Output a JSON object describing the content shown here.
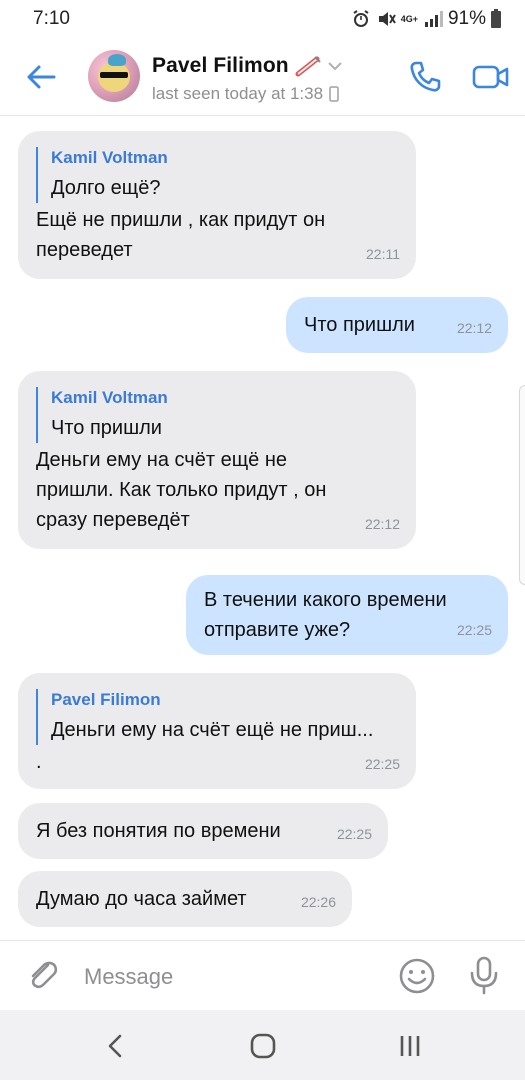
{
  "status_bar": {
    "time": "7:10",
    "network": "4G+",
    "battery": "91%"
  },
  "header": {
    "contact_name": "Pavel Filimon",
    "last_seen": "last seen today at 1:38"
  },
  "messages": [
    {
      "direction": "incoming",
      "reply_author": "Kamil Voltman",
      "reply_quote": "Долго ещё?",
      "text": "Ещё не пришли , как придут он\nпереведет",
      "time": "22:11"
    },
    {
      "direction": "outgoing",
      "text": "Что  пришли",
      "time": "22:12"
    },
    {
      "direction": "incoming",
      "reply_author": "Kamil Voltman",
      "reply_quote": "Что  пришли",
      "text": "Деньги ему на счёт ещё не\nпришли. Как только придут , он\nсразу переведёт",
      "time": "22:12"
    },
    {
      "direction": "outgoing",
      "text": "В течении какого времени\nотправите уже?",
      "time": "22:25"
    },
    {
      "direction": "incoming",
      "reply_author": "Pavel Filimon",
      "reply_quote": "Деньги ему на счёт ещё не приш...",
      "text": ".",
      "time": "22:25"
    },
    {
      "direction": "incoming",
      "text": "Я без понятия по времени",
      "time": "22:25"
    },
    {
      "direction": "incoming",
      "text": "Думаю до часа займет",
      "time": "22:26"
    }
  ],
  "input": {
    "placeholder": "Message"
  },
  "icons": {
    "back": "back-arrow-icon",
    "phone": "phone-icon",
    "video": "video-camera-icon",
    "attach": "paperclip-icon",
    "emoji": "emoji-icon",
    "mic": "microphone-icon"
  },
  "colors": {
    "accent": "#3a86e0",
    "incoming_bubble": "#ebebee",
    "outgoing_bubble": "#cce4ff"
  }
}
